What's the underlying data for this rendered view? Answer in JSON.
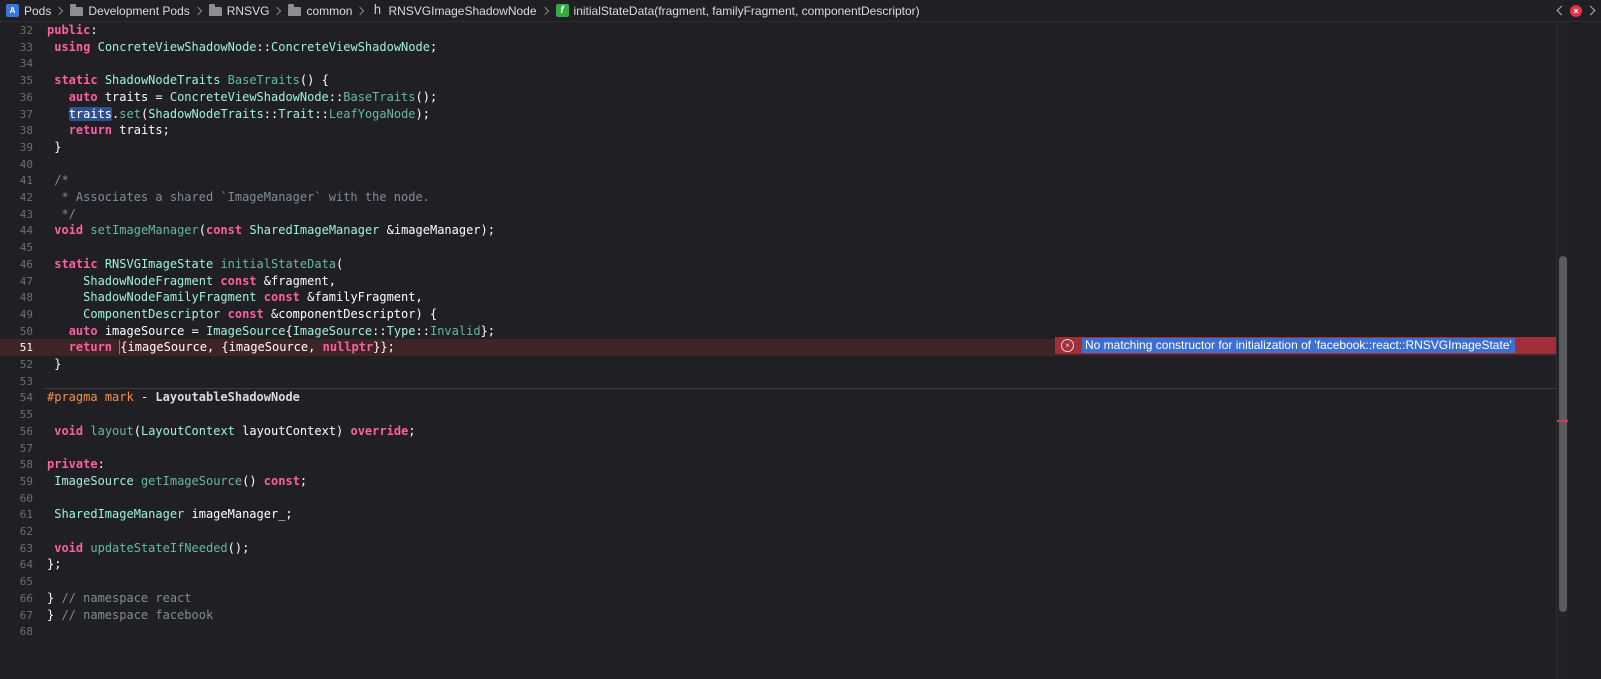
{
  "breadcrumb": [
    {
      "label": "Pods",
      "icon": "project-icon"
    },
    {
      "label": "Development Pods",
      "icon": "folder-icon"
    },
    {
      "label": "RNSVG",
      "icon": "folder-icon"
    },
    {
      "label": "common",
      "icon": "folder-icon"
    },
    {
      "label": "RNSVGImageShadowNode",
      "icon": "header-file-icon"
    },
    {
      "label": "initialStateData(fragment, familyFragment, componentDescriptor)",
      "icon": "function-icon"
    }
  ],
  "icons": {
    "project": "A",
    "header": "h",
    "function": "f",
    "error": "×"
  },
  "colors": {
    "background": "#1f1f24",
    "error_line": "#3f2426",
    "error_banner": "#a02f3a",
    "selection": "#3d6fd0"
  },
  "editor": {
    "current_line": "51",
    "lines": [
      {
        "n": "32",
        "text": "public:"
      },
      {
        "n": "33",
        "text": " using ConcreteViewShadowNode::ConcreteViewShadowNode;"
      },
      {
        "n": "34",
        "text": ""
      },
      {
        "n": "35",
        "text": " static ShadowNodeTraits BaseTraits() {"
      },
      {
        "n": "36",
        "text": "   auto traits = ConcreteViewShadowNode::BaseTraits();"
      },
      {
        "n": "37",
        "text": "   traits.set(ShadowNodeTraits::Trait::LeafYogaNode);"
      },
      {
        "n": "38",
        "text": "   return traits;"
      },
      {
        "n": "39",
        "text": " }"
      },
      {
        "n": "40",
        "text": ""
      },
      {
        "n": "41",
        "text": " /*"
      },
      {
        "n": "42",
        "text": "  * Associates a shared `ImageManager` with the node."
      },
      {
        "n": "43",
        "text": "  */"
      },
      {
        "n": "44",
        "text": " void setImageManager(const SharedImageManager &imageManager);"
      },
      {
        "n": "45",
        "text": ""
      },
      {
        "n": "46",
        "text": " static RNSVGImageState initialStateData("
      },
      {
        "n": "47",
        "text": "     ShadowNodeFragment const &fragment,"
      },
      {
        "n": "48",
        "text": "     ShadowNodeFamilyFragment const &familyFragment,"
      },
      {
        "n": "49",
        "text": "     ComponentDescriptor const &componentDescriptor) {"
      },
      {
        "n": "50",
        "text": "   auto imageSource = ImageSource{ImageSource::Type::Invalid};"
      },
      {
        "n": "51",
        "text": "   return {imageSource, {imageSource, nullptr}};"
      },
      {
        "n": "52",
        "text": " }"
      },
      {
        "n": "53",
        "text": ""
      },
      {
        "n": "54",
        "text": "#pragma mark - LayoutableShadowNode"
      },
      {
        "n": "55",
        "text": ""
      },
      {
        "n": "56",
        "text": " void layout(LayoutContext layoutContext) override;"
      },
      {
        "n": "57",
        "text": ""
      },
      {
        "n": "58",
        "text": "private:"
      },
      {
        "n": "59",
        "text": " ImageSource getImageSource() const;"
      },
      {
        "n": "60",
        "text": ""
      },
      {
        "n": "61",
        "text": " SharedImageManager imageManager_;"
      },
      {
        "n": "62",
        "text": ""
      },
      {
        "n": "63",
        "text": " void updateStateIfNeeded();"
      },
      {
        "n": "64",
        "text": "};"
      },
      {
        "n": "65",
        "text": ""
      },
      {
        "n": "66",
        "text": "} // namespace react"
      },
      {
        "n": "67",
        "text": "} // namespace facebook"
      },
      {
        "n": "68",
        "text": ""
      }
    ]
  },
  "diagnostic": {
    "line": "51",
    "message": "No matching constructor for initialization of 'facebook::react::RNSVGImageState'"
  }
}
